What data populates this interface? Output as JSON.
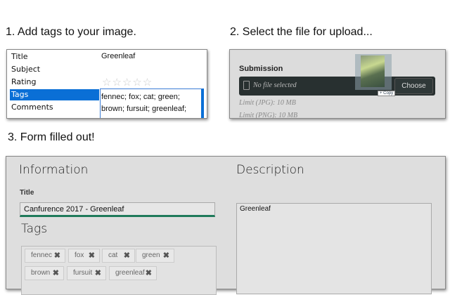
{
  "steps": [
    "1. Add tags to your image.",
    "2. Select the file for upload...",
    "3. Form filled out!"
  ],
  "properties": {
    "labels": [
      "Title",
      "Subject",
      "Rating",
      "Tags",
      "Comments"
    ],
    "title_value": "Greenleaf",
    "rating": 0,
    "stars": "☆☆☆☆☆",
    "tags_line1": "fennec; fox; cat; green;",
    "tags_line2": "brown; fursuit; greenleaf;"
  },
  "upload": {
    "heading": "Submission",
    "file_status": "No file selected",
    "choose_label": "Choose",
    "copy_tooltip": "+ Copy",
    "limits": [
      "Limit (JPG): 10 MB",
      "Limit (PNG): 10 MB"
    ]
  },
  "form": {
    "info_heading": "Information",
    "title_label": "Title",
    "title_value": "Canfurence 2017 - Greenleaf",
    "tags_heading": "Tags",
    "tags": [
      "fennec",
      "fox",
      "cat",
      "green",
      "brown",
      "fursuit",
      "greenleaf"
    ],
    "remove_glyph": "✖",
    "desc_heading": "Description",
    "desc_value": "Greenleaf"
  }
}
